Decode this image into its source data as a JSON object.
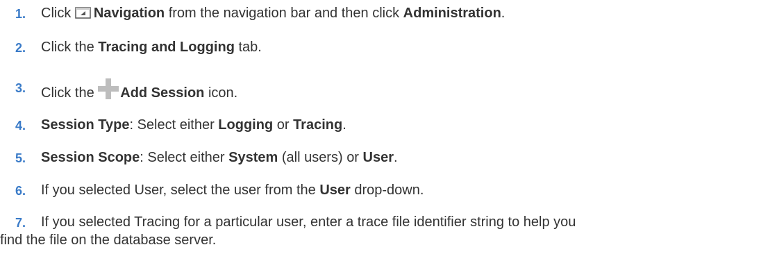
{
  "steps": [
    {
      "number": "1.",
      "t1": "Click ",
      "icon": "navigation-icon",
      "b1": "Navigation",
      "t2": " from the navigation bar and then click ",
      "b2": "Administration",
      "t3": "."
    },
    {
      "number": "2.",
      "t1": "Click the ",
      "b1": "Tracing and Logging",
      "t2": " tab."
    },
    {
      "number": "3.",
      "t1": "Click the ",
      "icon": "add-session-plus-icon",
      "b1": "Add Session",
      "t2": " icon."
    },
    {
      "number": "4.",
      "b1": "Session Type",
      "t1": ": Select either ",
      "b2": "Logging",
      "t2": " or ",
      "b3": "Tracing",
      "t3": "."
    },
    {
      "number": "5.",
      "b1": "Session Scope",
      "t1": ": Select either ",
      "b2": "System",
      "t2": " (all users) or ",
      "b3": "User",
      "t3": "."
    },
    {
      "number": "6.",
      "t1": "If you selected User, select the user from the ",
      "b1": "User",
      "t2": " drop-down."
    },
    {
      "number": "7.",
      "line1": "If you selected Tracing for a particular user, enter a trace file identifier string to help you",
      "line2": "find the file on the database server."
    }
  ],
  "colors": {
    "step_number": "#3a7bc8",
    "text": "#333333",
    "icon_plus": "#bdbdbd"
  }
}
